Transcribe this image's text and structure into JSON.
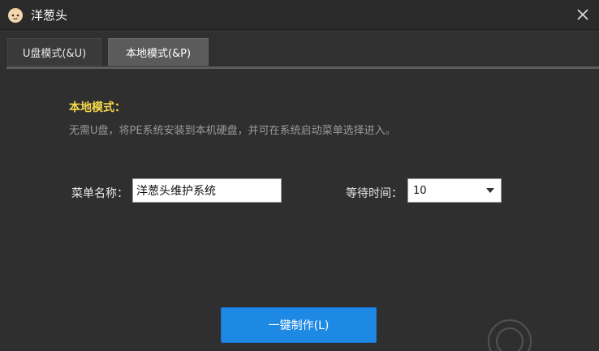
{
  "window": {
    "title": "洋葱头",
    "app_icon": "onion-face-icon",
    "close_icon": "close-icon"
  },
  "tabs": [
    {
      "label": "U盘模式(&U)",
      "active": false
    },
    {
      "label": "本地模式(&P)",
      "active": true
    }
  ],
  "local_mode": {
    "heading": "本地模式：",
    "description": "无需U盘，将PE系统安装到本机硬盘，并可在系统启动菜单选择进入。"
  },
  "form": {
    "menu_name_label": "菜单名称：",
    "menu_name_value": "洋葱头维护系统",
    "wait_time_label": "等待时间：",
    "wait_time_value": "10"
  },
  "actions": {
    "make_button_label": "一键制作(L)"
  },
  "colors": {
    "accent_button": "#1e88e5",
    "heading_yellow": "#f6d84a",
    "background": "#2f2f2f"
  }
}
